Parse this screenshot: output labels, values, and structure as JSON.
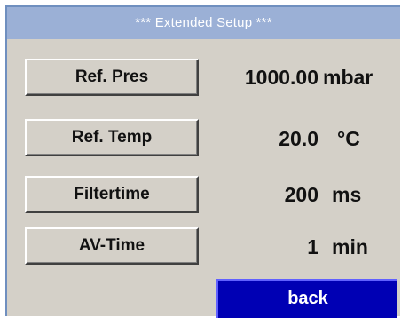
{
  "header": {
    "title": "***   Extended Setup ***"
  },
  "rows": [
    {
      "label": "Ref. Pres",
      "value": "1000.00",
      "unit": "mbar"
    },
    {
      "label": "Ref. Temp",
      "value": "20.0",
      "unit": "°C"
    },
    {
      "label": "Filtertime",
      "value": "200",
      "unit": "ms"
    },
    {
      "label": "AV-Time",
      "value": "1",
      "unit": "min"
    }
  ],
  "footer": {
    "back_label": "back"
  },
  "colors": {
    "title_bar": "#9bb0d6",
    "panel": "#d4d0c8",
    "back_button": "#0000b4"
  }
}
